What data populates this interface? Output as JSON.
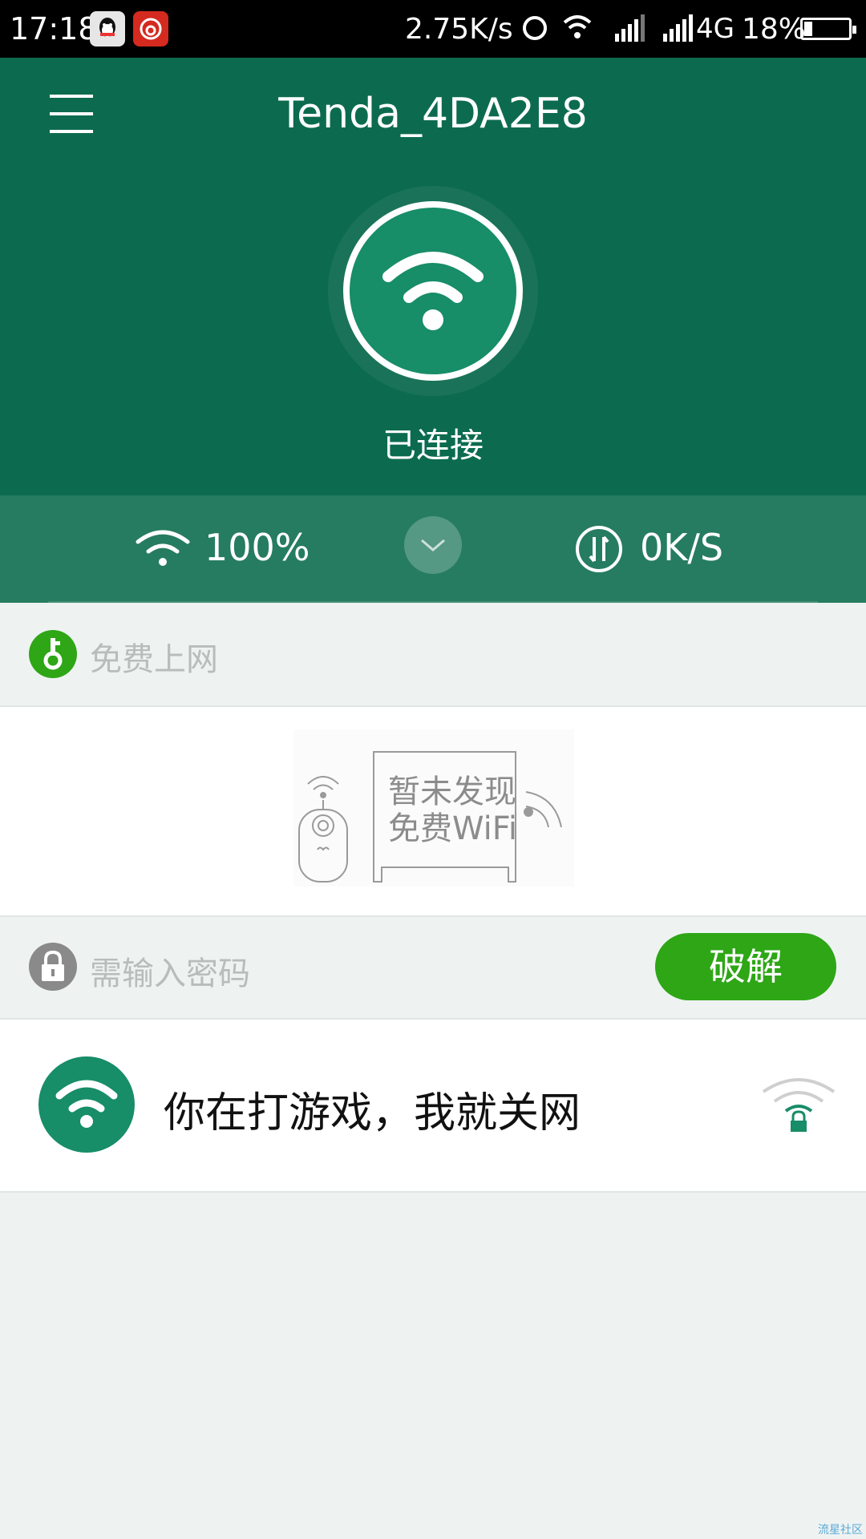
{
  "status_bar": {
    "time": "17:18",
    "net_speed": "2.75K/s",
    "network_type": "4G",
    "battery_percent": "18%",
    "battery_level": 0.18,
    "icons": [
      "qq-icon",
      "netease-music-icon",
      "alarm-icon",
      "wifi-icon",
      "signal-icon",
      "signal-icon",
      "battery-icon"
    ]
  },
  "header": {
    "title": "Tenda_4DA2E8",
    "status": "已连接"
  },
  "stats": {
    "signal": "100%",
    "speed": "0K/S"
  },
  "free_section": {
    "label": "免费上网",
    "empty_line1": "暂未发现",
    "empty_line2": "免费WiFi"
  },
  "password_section": {
    "label": "需输入密码",
    "crack_button": "破解"
  },
  "networks": [
    {
      "name": "你在打游戏，我就关网",
      "locked": true
    }
  ],
  "watermark": "流星社区",
  "colors": {
    "header_green": "#0c6b4f",
    "stats_green": "#267c60",
    "accent_green": "#178d68",
    "button_green": "#2ea616",
    "background": "#eef3f2"
  }
}
